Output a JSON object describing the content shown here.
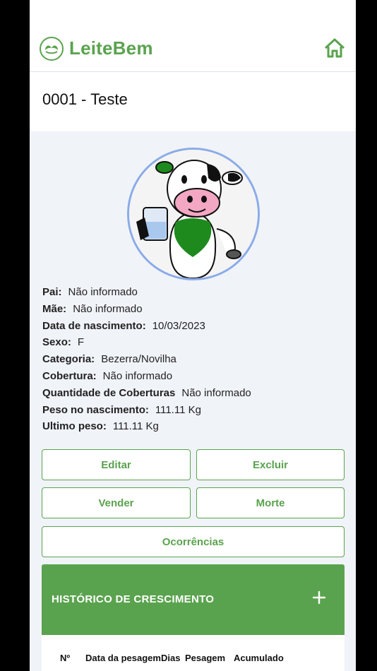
{
  "app": {
    "brand": "LeiteBem"
  },
  "animal": {
    "title": "0001 - Teste"
  },
  "details": [
    {
      "label": "Pai:",
      "value": "Não informado"
    },
    {
      "label": "Mãe:",
      "value": "Não informado"
    },
    {
      "label": "Data de nascimento:",
      "value": "10/03/2023"
    },
    {
      "label": "Sexo:",
      "value": "F"
    },
    {
      "label": "Categoria:",
      "value": "Bezerra/Novilha"
    },
    {
      "label": "Cobertura:",
      "value": "Não informado"
    },
    {
      "label": "Quantidade de Coberturas",
      "value": "Não informado"
    },
    {
      "label": "Peso no nascimento:",
      "value": "111.11 Kg"
    },
    {
      "label": "Ultimo peso:",
      "value": "111.11 Kg"
    }
  ],
  "actions": {
    "edit": "Editar",
    "delete": "Excluir",
    "sell": "Vender",
    "death": "Morte",
    "occurrences": "Ocorrências"
  },
  "growth": {
    "title": "HISTÓRICO DE CRESCIMENTO",
    "columns": [
      "Nº",
      "Data da pesagem",
      "Dias",
      "Pesagem",
      "Acumulado"
    ]
  },
  "colors": {
    "accent": "#5aa34e",
    "avatar_ring": "#8aabe8",
    "background": "#f0f3f8"
  },
  "icons": {
    "home": "home-icon",
    "add": "plus-icon",
    "logo": "leaf-logo-icon"
  }
}
